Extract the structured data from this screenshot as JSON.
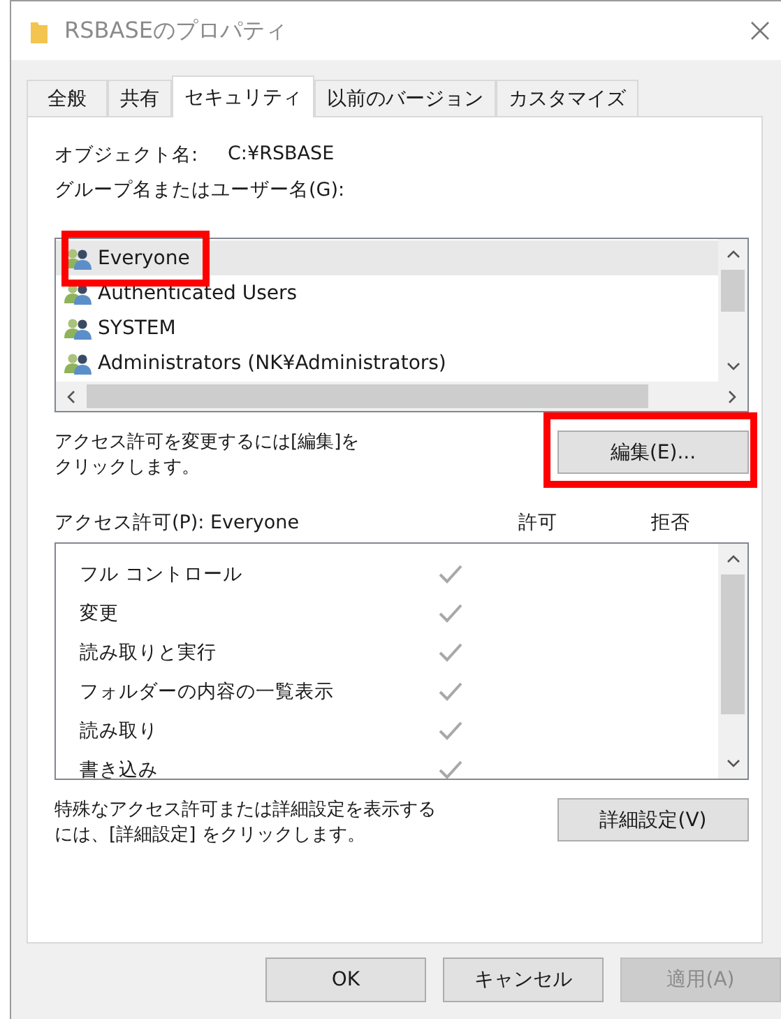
{
  "window": {
    "title": "RSBASEのプロパティ"
  },
  "tabs": [
    {
      "label": "全般",
      "selected": false
    },
    {
      "label": "共有",
      "selected": false
    },
    {
      "label": "セキュリティ",
      "selected": true
    },
    {
      "label": "以前のバージョン",
      "selected": false
    },
    {
      "label": "カスタマイズ",
      "selected": false
    }
  ],
  "object_name": {
    "label": "オブジェクト名:",
    "value": "C:¥RSBASE"
  },
  "users_label": "グループ名またはユーザー名(G):",
  "users": [
    {
      "name": "Everyone",
      "selected": true,
      "highlighted": true
    },
    {
      "name": "Authenticated Users",
      "selected": false,
      "highlighted": false
    },
    {
      "name": "SYSTEM",
      "selected": false,
      "highlighted": false
    },
    {
      "name": "Administrators (NK¥Administrators)",
      "selected": false,
      "highlighted": false
    }
  ],
  "edit_hint": [
    "アクセス許可を変更するには[編集]を",
    "クリックします。"
  ],
  "edit_button": {
    "label": "編集(E)...",
    "highlighted": true
  },
  "permissions_header": {
    "label": "アクセス許可(P): Everyone",
    "allow": "許可",
    "deny": "拒否"
  },
  "permissions": [
    {
      "name": "フル コントロール",
      "allow": true,
      "deny": false
    },
    {
      "name": "変更",
      "allow": true,
      "deny": false
    },
    {
      "name": "読み取りと実行",
      "allow": true,
      "deny": false
    },
    {
      "name": "フォルダーの内容の一覧表示",
      "allow": true,
      "deny": false
    },
    {
      "name": "読み取り",
      "allow": true,
      "deny": false
    },
    {
      "name": "書き込み",
      "allow": true,
      "deny": false
    }
  ],
  "advanced_hint": [
    "特殊なアクセス許可または詳細設定を表示する",
    "には、[詳細設定] をクリックします。"
  ],
  "advanced_button": "詳細設定(V)",
  "buttons": [
    {
      "label": "OK",
      "disabled": false
    },
    {
      "label": "キャンセル",
      "disabled": false
    },
    {
      "label": "適用(A)",
      "disabled": true
    }
  ]
}
